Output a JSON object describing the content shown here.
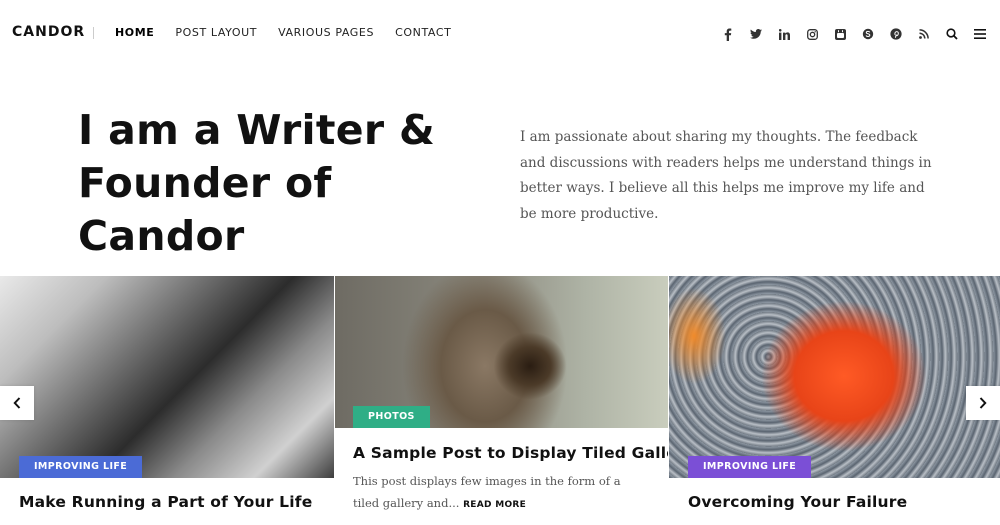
{
  "header": {
    "logo": "CANDOR",
    "nav": [
      "HOME",
      "POST LAYOUT",
      "VARIOUS PAGES",
      "CONTACT"
    ],
    "icons": [
      "facebook-icon",
      "twitter-icon",
      "linkedin-icon",
      "instagram-icon",
      "youtube-icon",
      "skype-icon",
      "pinterest-icon",
      "rss-icon",
      "search-icon",
      "menu-icon"
    ]
  },
  "hero": {
    "title_line1": "I am a Writer &",
    "title_line2": "Founder of Candor",
    "text": "I am passionate about sharing my thoughts. The feedback and discussions with readers helps me understand things in better ways. I believe all this helps me improve my life and be more productive."
  },
  "posts": [
    {
      "category": "IMPROVING LIFE",
      "category_color": "#4b6bd6",
      "title": "Make Running a Part of Your Life"
    },
    {
      "category": "PHOTOS",
      "category_color": "#2fae86",
      "title": "A Sample Post to Display Tiled Gallery",
      "excerpt": "This post displays few images in the form of a tiled gallery and...",
      "read_more": "READ MORE"
    },
    {
      "category": "IMPROVING LIFE",
      "category_color": "#7b4fd6",
      "title": "Overcoming Your Failure"
    }
  ],
  "slider": {
    "prev_icon": "chevron-left-icon",
    "next_icon": "chevron-right-icon"
  }
}
